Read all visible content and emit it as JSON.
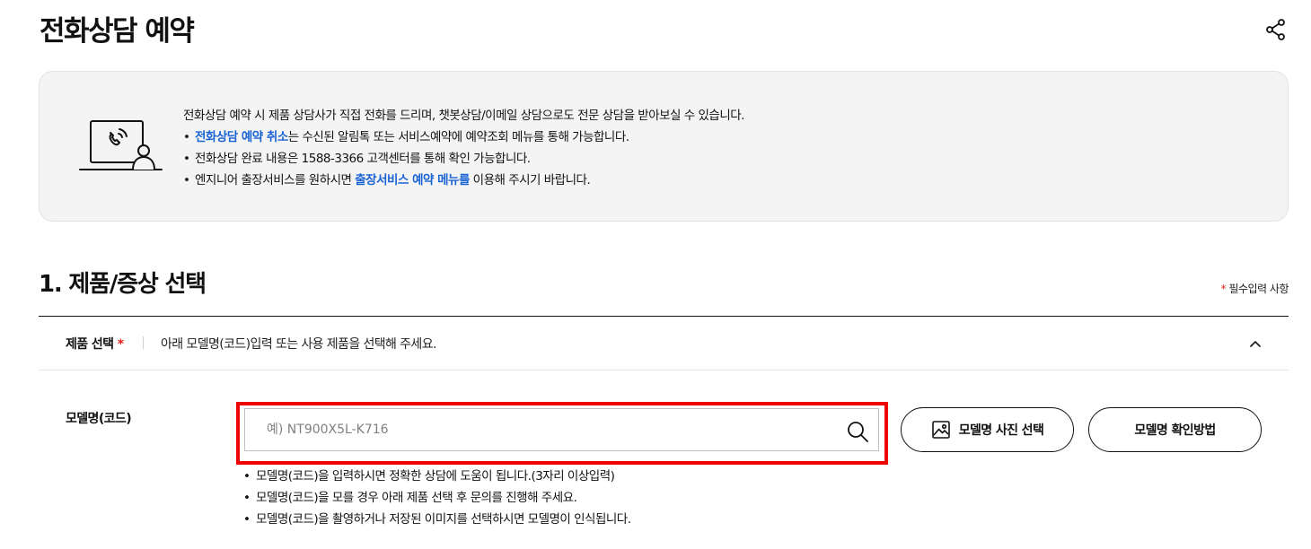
{
  "page": {
    "title": "전화상담 예약"
  },
  "notice": {
    "line1": "전화상담 예약 시 제품 상담사가 직접 전화를 드리며, 챗봇상담/이메일 상담으로도 전문 상담을 받아보실 수 있습니다.",
    "line2_link": "전화상담 예약 취소",
    "line2_rest": "는 수신된 알림톡 또는 서비스예약에 예약조회 메뉴를 통해 가능합니다.",
    "line3": "전화상담 완료 내용은 1588-3366 고객센터를 통해 확인 가능합니다.",
    "line4_pre": "엔지니어 출장서비스를 원하시면 ",
    "line4_link": "출장서비스 예약 메뉴를",
    "line4_post": " 이용해 주시기 바랍니다.",
    "bullet": "•"
  },
  "section": {
    "title": "1. 제품/증상 선택",
    "required_star": "*",
    "required_text": " 필수입력 사항"
  },
  "product_select": {
    "label": "제품 선택",
    "required_star": "*",
    "guide": "아래 모델명(코드)입력 또는 사용 제품을 선택해 주세요."
  },
  "model_code": {
    "label": "모델명(코드)",
    "placeholder": "예) NT900X5L-K716",
    "value": "",
    "photo_button": "모델명 사진 선택",
    "method_button": "모델명 확인방법",
    "hints": [
      "모델명(코드)을 입력하시면 정확한 상담에 도움이 됩니다.(3자리 이상입력)",
      "모델명(코드)을 모를 경우 아래 제품 선택 후 문의를 진행해 주세요.",
      "모델명(코드)을 촬영하거나 저장된 이미지를 선택하시면 모델명이 인식됩니다."
    ]
  },
  "icons": {
    "share": "share-icon",
    "phone_consult": "phone-consult-illustration",
    "chevron": "chevron-up-icon",
    "search": "search-icon",
    "image": "image-icon"
  },
  "colors": {
    "link_blue": "#1a63d3",
    "required_red": "#e0221a",
    "highlight_red": "#f00000",
    "notice_bg": "#f4f4f4"
  }
}
